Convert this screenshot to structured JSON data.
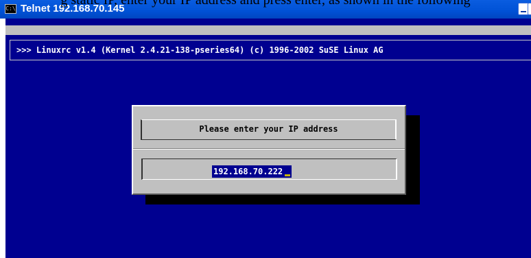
{
  "document": {
    "instruction_text": "g static IP, enter your IP address and press enter, as shown in the following"
  },
  "window": {
    "title": "Telnet 192.168.70.145",
    "icon": "console-app-icon",
    "icon_glyph": "C:\\"
  },
  "terminal": {
    "header": ">>> Linuxrc v1.4 (Kernel 2.4.21-138-pseries64) (c) 1996-2002 SuSE Linux AG",
    "background_color": "#000090",
    "dialog": {
      "prompt": "Please enter your IP address",
      "ip_value": "192.168.70.222"
    }
  }
}
